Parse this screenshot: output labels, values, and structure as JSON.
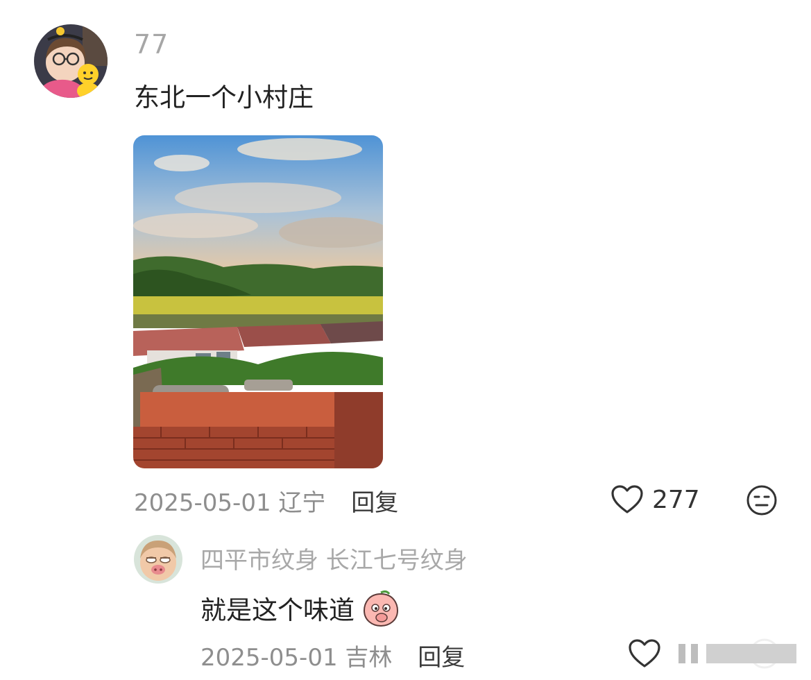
{
  "main_comment": {
    "username": "77",
    "text": "东北一个小村庄",
    "date": "2025-05-01",
    "location": "辽宁",
    "reply_label": "回复",
    "likes": "277",
    "avatar_icon": "user-avatar-girl-with-glasses",
    "photo_icon": "village-landscape-photo"
  },
  "reply_comment": {
    "username": "四平市纹身 长江七号纹身",
    "text": "就是这个味道",
    "emoji_icon": "peach-thinking-emoji",
    "date": "2025-05-01",
    "location": "吉林",
    "reply_label": "回复",
    "avatar_icon": "user-avatar-cartoon-face"
  },
  "colors": {
    "meta_text": "#8e8e8e",
    "username": "#a6a6a6",
    "body_text": "#222222"
  }
}
